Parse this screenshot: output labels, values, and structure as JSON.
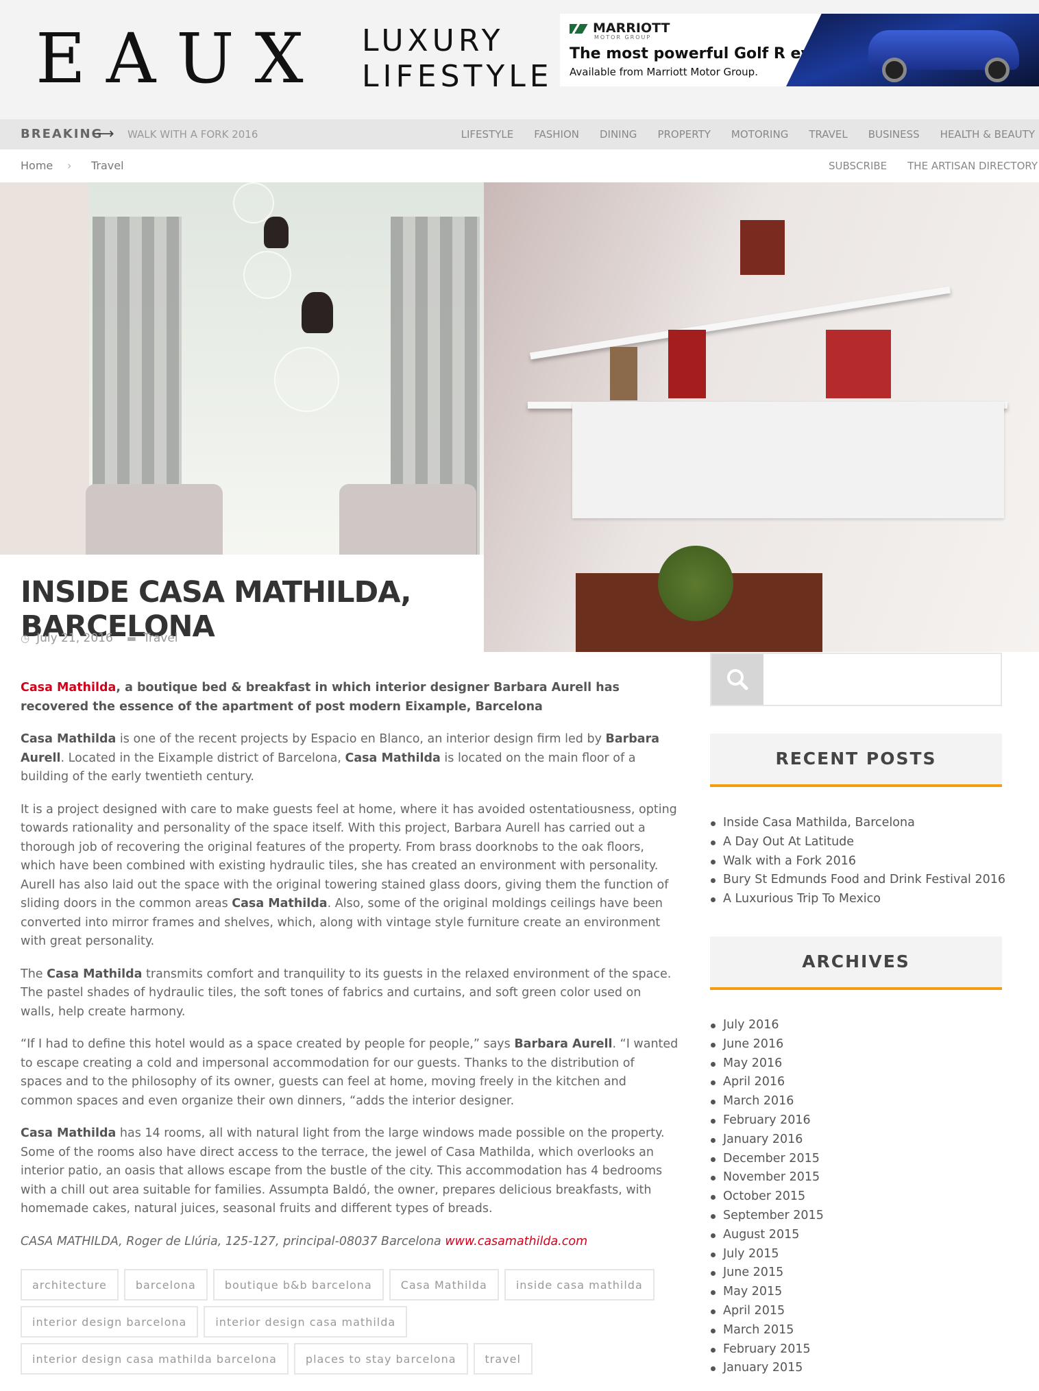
{
  "header": {
    "logo_main": "EAUX",
    "logo_sub_1": "LUXURY",
    "logo_sub_2": "LIFESTYLE",
    "ad": {
      "brand": "MARRIOTT",
      "brand_sub": "MOTOR GROUP",
      "headline": "The most powerful Golf R ever.",
      "subline": "Available from Marriott Motor Group."
    }
  },
  "nav": {
    "breaking_label": "BREAKING",
    "arrow": "⟶",
    "breaking_link": "WALK WITH A FORK 2016",
    "menu": [
      "LIFESTYLE",
      "FASHION",
      "DINING",
      "PROPERTY",
      "MOTORING",
      "TRAVEL",
      "BUSINESS",
      "HEALTH & BEAUTY"
    ]
  },
  "subbar": {
    "breadcrumb": {
      "home": "Home",
      "sep": "›",
      "current": "Travel"
    },
    "links": [
      "SUBSCRIBE",
      "THE ARTISAN DIRECTORY"
    ]
  },
  "post": {
    "title": "INSIDE CASA MATHILDA, BARCELONA",
    "date": "July 21, 2016",
    "category": "Travel",
    "lead_link": "Casa Mathilda",
    "lead_rest": ", a boutique bed & breakfast in which interior designer Barbara Aurell has recovered the essence of the apartment of post modern Eixample, Barcelona",
    "p1": {
      "a": "Casa Mathilda",
      "b": " is one of the recent projects by Espacio en Blanco, an interior design firm led by ",
      "c": "Barbara Aurell",
      "d": ". Located in the Eixample district of Barcelona, ",
      "e": "Casa Mathilda",
      "f": " is located on the main floor of a building of the early twentieth century."
    },
    "p2": {
      "a": "It is a project designed with care to make guests feel at home, where it has avoided ostentatiousness, opting towards rationality and personality of the space itself. With this project, Barbara Aurell has carried out a thorough job of recovering the original features of the property. From brass doorknobs to the oak floors, which have been combined with existing hydraulic tiles, she has created an environment with personality. Aurell has also laid out the space with the original towering stained glass doors, giving them the function of sliding doors in the common areas ",
      "b": "Casa Mathilda",
      "c": ". Also, some of the original moldings ceilings have been converted into mirror frames and shelves, which, along with vintage style furniture create an environment with great personality."
    },
    "p3": {
      "a": "The ",
      "b": "Casa Mathilda",
      "c": " transmits comfort and tranquility to its guests in the relaxed environment of the space. The pastel shades of hydraulic tiles, the soft tones of fabrics and curtains, and soft green color used on walls, help create harmony."
    },
    "p4": {
      "a": "“If I had to define this hotel would as a space created by people for people,” says ",
      "b": "Barbara Aurell",
      "c": ". “I wanted to escape creating a cold and impersonal accommodation for our guests. Thanks to the distribution of spaces and to the philosophy of its owner, guests can feel at home, moving freely in the kitchen and common spaces and even organize their own dinners, “adds the interior designer."
    },
    "p5": {
      "a": "Casa Mathilda",
      "b": " has 14 rooms, all with natural light from the large windows made possible on the property. Some of the rooms also have direct access to the terrace, the jewel of Casa Mathilda, which overlooks an interior patio, an oasis that allows escape from the bustle of the city. This accommodation has 4 bedrooms with a chill out area suitable for families. Assumpta Baldó, the owner, prepares delicious breakfasts, with homemade cakes, natural juices, seasonal fruits and different types of breads."
    },
    "address_text": "CASA MATHILDA, Roger de Llúria, 125-127, principal-08037 Barcelona ",
    "address_link": "www.casamathilda.com",
    "tags": [
      "architecture",
      "barcelona",
      "boutique b&b barcelona",
      "Casa Mathilda",
      "inside casa mathilda",
      "interior design barcelona",
      "interior design casa mathilda",
      "interior design casa mathilda barcelona",
      "places to stay barcelona",
      "travel"
    ]
  },
  "sidebar": {
    "search_placeholder": "",
    "recent_title": "RECENT POSTS",
    "recent": [
      "Inside Casa Mathilda, Barcelona",
      "A Day Out At Latitude",
      "Walk with a Fork 2016",
      "Bury St Edmunds Food and Drink Festival 2016",
      "A Luxurious Trip To Mexico"
    ],
    "archives_title": "ARCHIVES",
    "archives": [
      "July 2016",
      "June 2016",
      "May 2016",
      "April 2016",
      "March 2016",
      "February 2016",
      "January 2016",
      "December 2015",
      "November 2015",
      "October 2015",
      "September 2015",
      "August 2015",
      "July 2015",
      "June 2015",
      "May 2015",
      "April 2015",
      "March 2015",
      "February 2015",
      "January 2015"
    ]
  },
  "colors": {
    "accent": "#f39c12",
    "link_red": "#d0021b"
  },
  "icons": {
    "search": "search-icon",
    "clock": "clock-icon",
    "folder": "folder-icon"
  }
}
